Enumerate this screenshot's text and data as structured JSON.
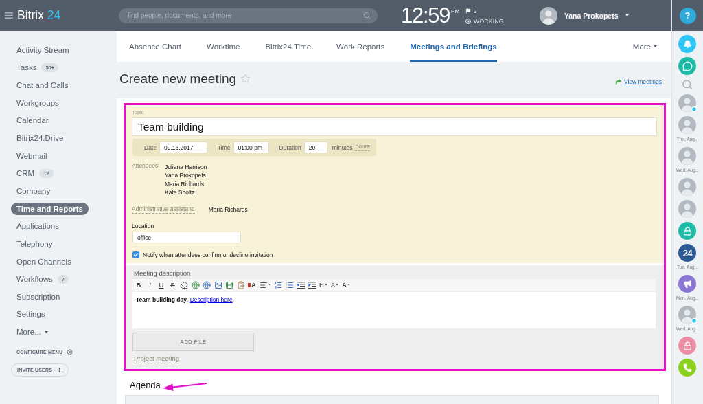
{
  "top_bar": {
    "logo": {
      "name": "Bitrix",
      "accent": "24"
    },
    "search": {
      "placeholder": "find people, documents, and more"
    },
    "clock": {
      "time": "12:59",
      "period": "PM"
    },
    "flag_count": "3",
    "status": "WORKING",
    "user": {
      "name": "Yana Prokopets"
    },
    "help": "?"
  },
  "sidebar": {
    "items": [
      {
        "label": "Activity Stream",
        "selected": false
      },
      {
        "label": "Tasks",
        "count": "50+",
        "selected": false
      },
      {
        "label": "Chat and Calls",
        "selected": false
      },
      {
        "label": "Workgroups",
        "selected": false
      },
      {
        "label": "Calendar",
        "selected": false
      },
      {
        "label": "Bitrix24.Drive",
        "selected": false
      },
      {
        "label": "Webmail",
        "selected": false
      },
      {
        "label": "CRM",
        "count": "12",
        "selected": false
      },
      {
        "label": "Company",
        "selected": false
      },
      {
        "label": "Time and Reports",
        "selected": true
      },
      {
        "label": "Applications",
        "selected": false
      },
      {
        "label": "Telephony",
        "selected": false
      },
      {
        "label": "Open Channels",
        "selected": false
      },
      {
        "label": "Workflows",
        "count": "7",
        "selected": false
      },
      {
        "label": "Subscription",
        "selected": false
      },
      {
        "label": "Settings",
        "selected": false
      }
    ],
    "more": "More...",
    "configure": "CONFIGURE MENU",
    "invite": "INVITE USERS"
  },
  "tabs": {
    "items": [
      {
        "label": "Absence Chart",
        "selected": false
      },
      {
        "label": "Worktime",
        "selected": false
      },
      {
        "label": "Bitrix24.Time",
        "selected": false
      },
      {
        "label": "Work Reports",
        "selected": false
      },
      {
        "label": "Meetings and Briefings",
        "selected": true
      }
    ],
    "more": "More"
  },
  "page": {
    "title": "Create new meeting",
    "starred": false,
    "view_link": "View meetings"
  },
  "form": {
    "topic": {
      "label": "Topic",
      "value": "Team building"
    },
    "schedule": {
      "date_label": "Date",
      "date": "09.13.2017",
      "time_label": "Time",
      "time": "01:00 pm",
      "duration_label": "Duration",
      "duration": "20",
      "unit": "minutes",
      "alt_unit": "hours"
    },
    "attendees": {
      "label": "Attendees:",
      "names": [
        "Juliana Harrison",
        "Yana Prokopets",
        "Maria Richards",
        "Kate Sholtz"
      ]
    },
    "assistant": {
      "label": "Administrative assistant:",
      "name": "Maria Richards"
    },
    "location": {
      "label": "Location",
      "value": "office"
    },
    "notify": {
      "label": "Notify when attendees confirm or decline invitation",
      "checked": true
    },
    "description": {
      "label": "Meeting description",
      "toolbar": [
        {
          "kind": "bold",
          "text": "B"
        },
        {
          "kind": "italic",
          "text": "I"
        },
        {
          "kind": "underline",
          "text": "U"
        },
        {
          "kind": "strike",
          "text": "S"
        },
        {
          "kind": "eraser"
        },
        {
          "kind": "link"
        },
        {
          "kind": "unlink"
        },
        {
          "kind": "image"
        },
        {
          "kind": "video"
        },
        {
          "kind": "paste"
        },
        {
          "kind": "style",
          "text": "A"
        },
        {
          "kind": "align"
        },
        {
          "kind": "numbered_list"
        },
        {
          "kind": "bullet_list"
        },
        {
          "kind": "outdent"
        },
        {
          "kind": "indent"
        },
        {
          "kind": "heading",
          "text": "H"
        },
        {
          "kind": "font_size",
          "text": "A"
        },
        {
          "kind": "font_color",
          "text": "A"
        }
      ],
      "text": [
        {
          "kind": "bold",
          "text": "Team building day"
        },
        {
          "kind": "plain",
          "text": ". "
        },
        {
          "kind": "link",
          "text": "Description here"
        },
        {
          "kind": "plain",
          "text": "."
        }
      ]
    },
    "add_file": "ADD FILE",
    "project_link": "Project meeting"
  },
  "agenda": {
    "title": "Agenda"
  },
  "right_bar": {
    "items": [
      {
        "kind": "bell",
        "color": "#2fc6f6"
      },
      {
        "kind": "chat",
        "color": "#1fbaa6"
      },
      {
        "kind": "search"
      },
      {
        "kind": "avatar",
        "online": true
      },
      {
        "kind": "avatar",
        "online": false,
        "date": "Thu, Aug..."
      },
      {
        "kind": "avatar",
        "online": false,
        "date": "Wed, Aug..."
      },
      {
        "kind": "avatar",
        "online": false
      },
      {
        "kind": "avatar",
        "online": false
      },
      {
        "kind": "lock",
        "color": "#1fbaa6"
      },
      {
        "kind": "logo",
        "text": "24",
        "color": "#2c5a97",
        "date": "Tue, Aug..."
      },
      {
        "kind": "megaphone",
        "color": "#8c76d4",
        "date": "Mon, Aug..."
      },
      {
        "kind": "avatar",
        "online": true,
        "date": "Wed, Aug..."
      },
      {
        "kind": "lock",
        "color": "#ef8da6"
      },
      {
        "kind": "phone",
        "color": "#8bd11e"
      }
    ]
  }
}
